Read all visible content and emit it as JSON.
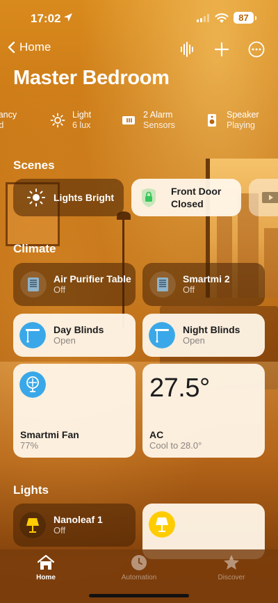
{
  "status_bar": {
    "time": "17:02",
    "battery": "87"
  },
  "nav": {
    "back_label": "Home"
  },
  "page": {
    "title": "Master Bedroom"
  },
  "summary": [
    {
      "line1": "ipancy",
      "line2": "ted",
      "icon": "occupancy-icon"
    },
    {
      "line1": "Light",
      "line2": "6 lux",
      "icon": "sun-icon"
    },
    {
      "line1": "2 Alarm",
      "line2": "Sensors",
      "icon": "alarm-sensor-icon"
    },
    {
      "line1": "Speaker",
      "line2": "Playing",
      "icon": "speaker-icon"
    }
  ],
  "sections": {
    "scenes": "Scenes",
    "climate": "Climate",
    "lights": "Lights"
  },
  "scenes": [
    {
      "name": "Lights Bright",
      "icon": "sun-icon",
      "style": "dark"
    },
    {
      "name": "Front Door",
      "name2": "Closed",
      "icon": "lock-icon",
      "style": "light"
    },
    {
      "icon": "tv-icon",
      "style": "light"
    }
  ],
  "climate": [
    {
      "name": "Air Purifier Table",
      "state": "Off",
      "icon": "air-purifier-icon",
      "style": "dark"
    },
    {
      "name": "Smartmi 2",
      "state": "Off",
      "icon": "air-purifier-icon",
      "style": "dark"
    },
    {
      "name": "Day Blinds",
      "state": "Open",
      "icon": "blinds-icon",
      "style": "light"
    },
    {
      "name": "Night Blinds",
      "state": "Open",
      "icon": "blinds-icon",
      "style": "light"
    },
    {
      "name": "Smartmi Fan",
      "state": "77%",
      "icon": "fan-icon",
      "style": "light"
    },
    {
      "name": "AC",
      "state": "Cool to 28.0°",
      "temperature": "27.5°",
      "style": "light"
    }
  ],
  "lights": [
    {
      "name": "Nanoleaf 1",
      "state": "Off",
      "icon": "lamp-icon",
      "style": "dark"
    },
    {
      "icon": "lamp-icon",
      "style": "light"
    }
  ],
  "tabs": [
    {
      "label": "Home",
      "active": true,
      "icon": "house-icon"
    },
    {
      "label": "Automation",
      "active": false,
      "icon": "clock-icon"
    },
    {
      "label": "Discover",
      "active": false,
      "icon": "star-icon"
    }
  ],
  "colors": {
    "accent_blue": "#3aa8e8",
    "lamp_yellow": "#ffcc00",
    "lock_green": "#34c759"
  }
}
